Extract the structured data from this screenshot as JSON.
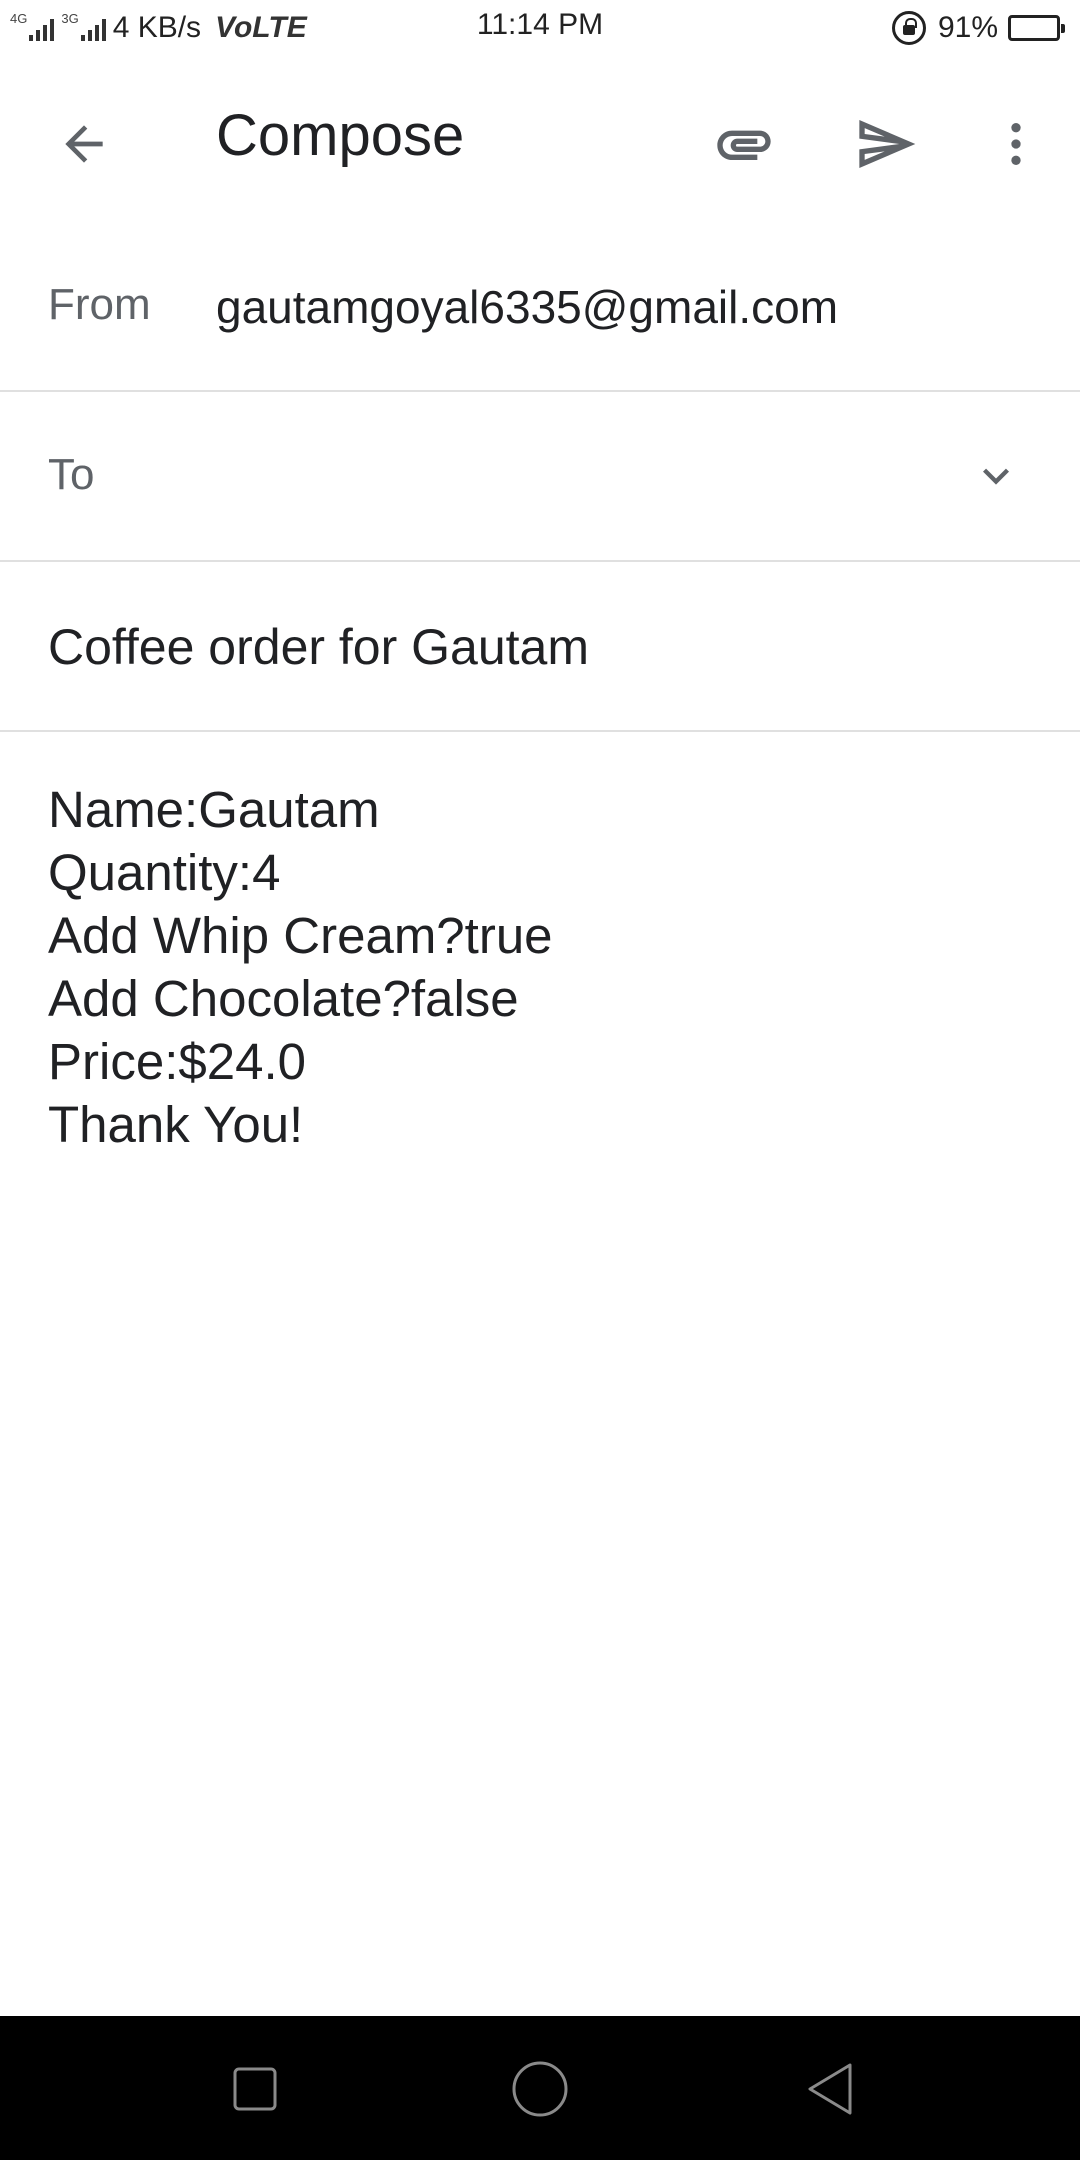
{
  "status_bar": {
    "network_badge_1": "4G",
    "network_badge_2": "3G",
    "speed": "4 KB/s",
    "volte": "VoLTE",
    "time": "11:14 PM",
    "battery": "91%",
    "battery_level": 0.91
  },
  "app_bar": {
    "title": "Compose",
    "icons": [
      "back-arrow-icon",
      "paperclip-icon",
      "send-icon",
      "more-vert-icon"
    ]
  },
  "compose": {
    "from_label": "From",
    "from_value": "gautamgoyal6335@gmail.com",
    "to_label": "To",
    "subject": "Coffee order for Gautam",
    "body_lines": [
      "Name:Gautam",
      "Quantity:4",
      "Add Whip Cream?true",
      "Add Chocolate?false",
      "Price:$24.0",
      "Thank You!"
    ]
  },
  "nav_bar": {
    "icons": [
      "recent-apps-icon",
      "home-icon",
      "back-icon"
    ]
  },
  "colors": {
    "text_primary": "#202124",
    "text_secondary": "#5f6368",
    "divider": "#e0e0e0",
    "nav_background": "#000000"
  }
}
